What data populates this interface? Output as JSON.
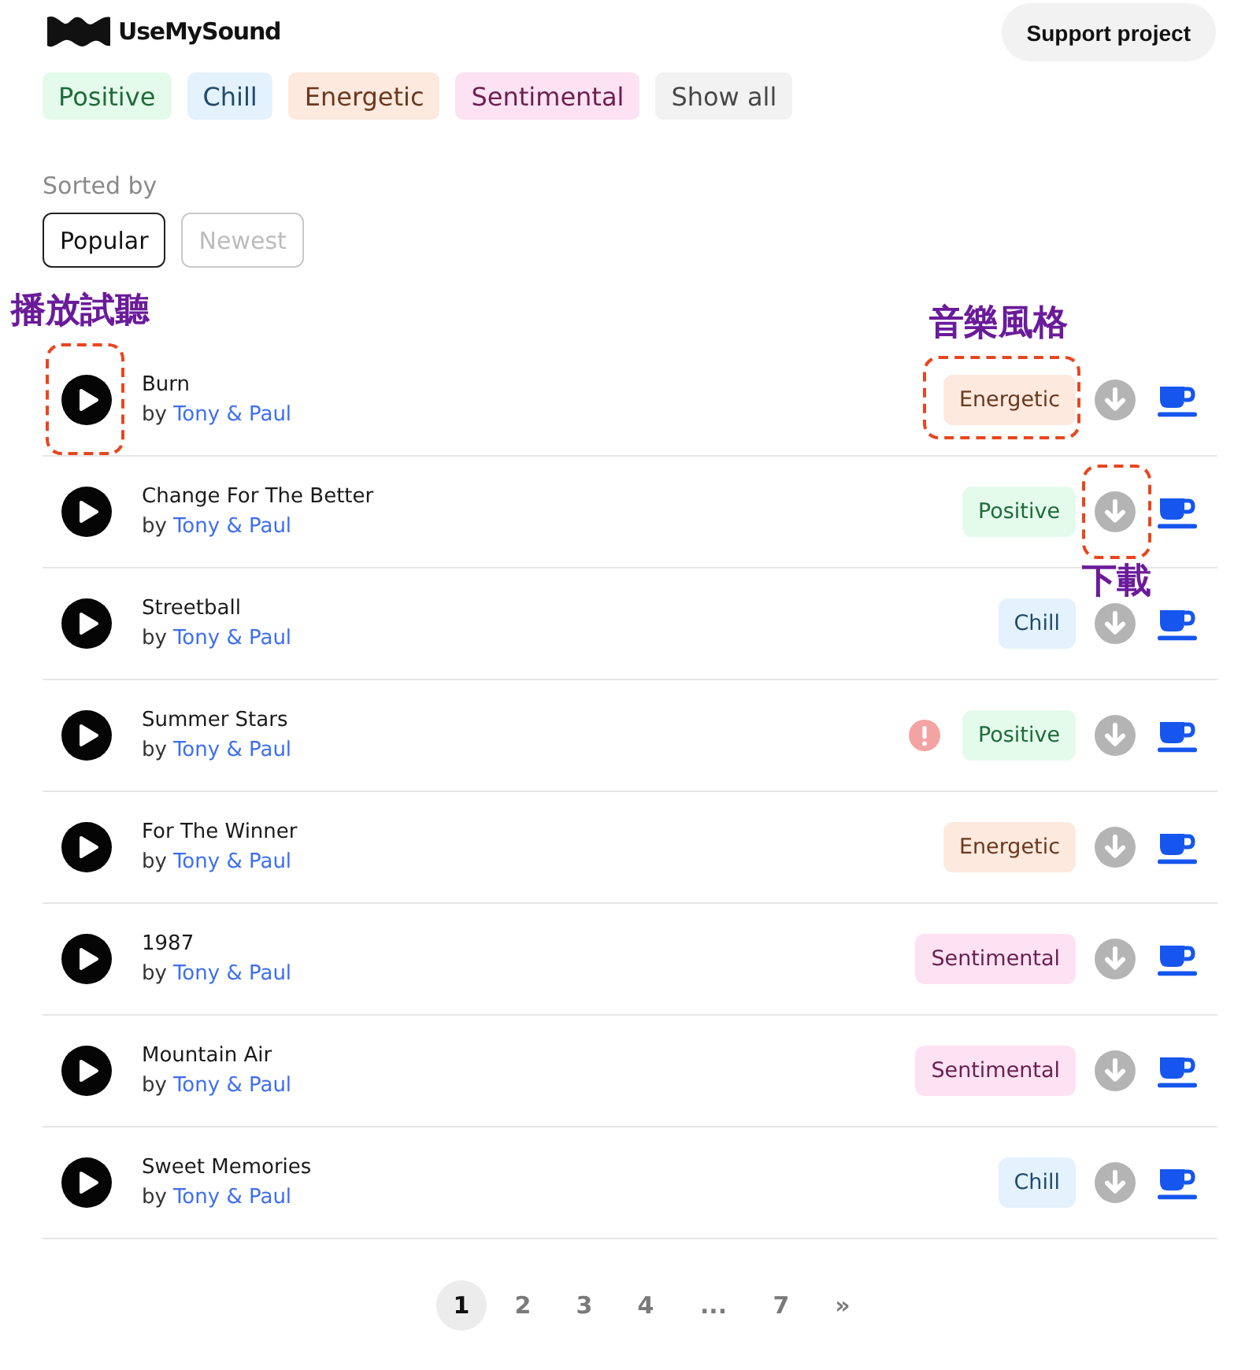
{
  "header": {
    "logo": "UseMySound",
    "support_button": "Support project"
  },
  "genre_filters": [
    {
      "label": "Positive",
      "color": "#e4fbec"
    },
    {
      "label": "Chill",
      "color": "#e3f2fd"
    },
    {
      "label": "Energetic",
      "color": "#fde9de"
    },
    {
      "label": "Sentimental",
      "color": "#fde2f3"
    },
    {
      "label": "Show all",
      "color": "#f2f2f2"
    }
  ],
  "sort": {
    "label": "Sorted by",
    "options": [
      {
        "label": "Popular",
        "selected": true
      },
      {
        "label": "Newest",
        "selected": false
      }
    ]
  },
  "songs": [
    {
      "title": "Burn",
      "by": "by",
      "artist": "Tony & Paul",
      "genre": {
        "label": "Energetic",
        "color": "#fde9de"
      },
      "warning": false,
      "callouts": [
        {
          "kind": "play",
          "label": "播放試聽"
        },
        {
          "kind": "genre",
          "label": "音樂風格"
        }
      ]
    },
    {
      "title": "Change For The Better",
      "by": "by",
      "artist": "Tony & Paul",
      "genre": {
        "label": "Positive",
        "color": "#e4fbec"
      },
      "warning": false,
      "callouts": [
        {
          "kind": "download",
          "label": "下載"
        }
      ]
    },
    {
      "title": "Streetball",
      "by": "by",
      "artist": "Tony & Paul",
      "genre": {
        "label": "Chill",
        "color": "#e3f2fd"
      },
      "warning": false
    },
    {
      "title": "Summer Stars",
      "by": "by",
      "artist": "Tony & Paul",
      "genre": {
        "label": "Positive",
        "color": "#e4fbec"
      },
      "warning": true
    },
    {
      "title": "For The Winner",
      "by": "by",
      "artist": "Tony & Paul",
      "genre": {
        "label": "Energetic",
        "color": "#fde9de"
      },
      "warning": false
    },
    {
      "title": "1987",
      "by": "by",
      "artist": "Tony & Paul",
      "genre": {
        "label": "Sentimental",
        "color": "#fde2f3"
      },
      "warning": false
    },
    {
      "title": "Mountain Air",
      "by": "by",
      "artist": "Tony & Paul",
      "genre": {
        "label": "Sentimental",
        "color": "#fde2f3"
      },
      "warning": false
    },
    {
      "title": "Sweet Memories",
      "by": "by",
      "artist": "Tony & Paul",
      "genre": {
        "label": "Chill",
        "color": "#e3f2fd"
      },
      "warning": false
    }
  ],
  "pagination": [
    {
      "label": "1",
      "kind": "page",
      "selected": true
    },
    {
      "label": "2",
      "kind": "page",
      "selected": false
    },
    {
      "label": "3",
      "kind": "page",
      "selected": false
    },
    {
      "label": "4",
      "kind": "page",
      "selected": false
    },
    {
      "label": "...",
      "kind": "gap",
      "selected": false
    },
    {
      "label": "7",
      "kind": "page",
      "selected": false
    },
    {
      "label": "»",
      "kind": "next",
      "selected": false
    }
  ]
}
